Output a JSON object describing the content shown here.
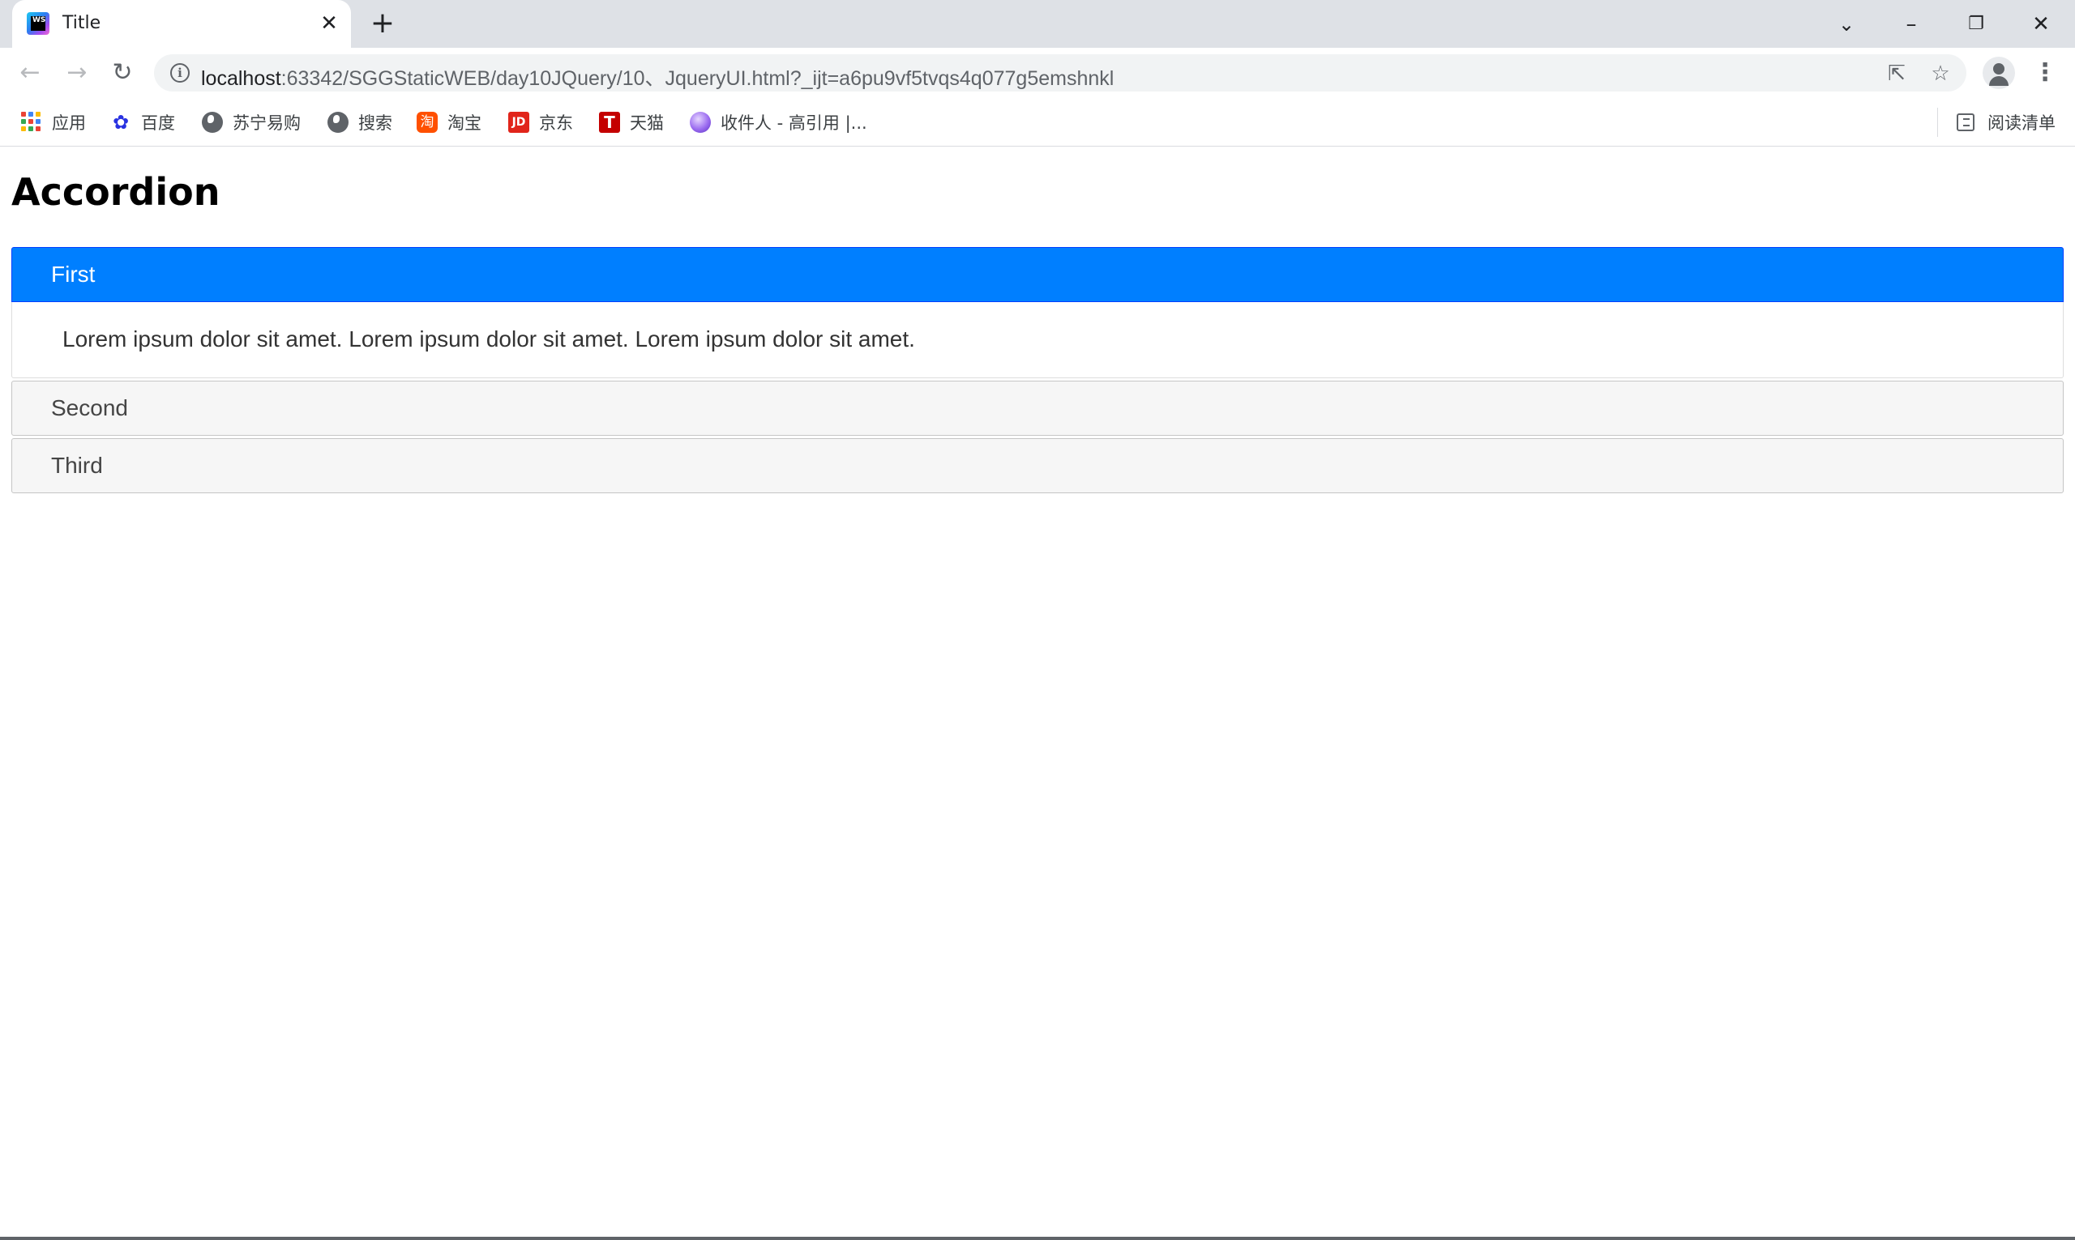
{
  "browser": {
    "tab_title": "Title",
    "tab_favicon_text": "WS",
    "url_host": "localhost",
    "url_rest": ":63342/SGGStaticWEB/day10JQuery/10、JqueryUI.html?_ijt=a6pu9vf5tvqs4q077g5emshnkl",
    "bookmarks": [
      {
        "label": "应用",
        "icon": "apps-icon"
      },
      {
        "label": "百度",
        "icon": "baidu-icon"
      },
      {
        "label": "苏宁易购",
        "icon": "globe-icon"
      },
      {
        "label": "搜索",
        "icon": "globe-icon"
      },
      {
        "label": "淘宝",
        "icon": "taobao-icon"
      },
      {
        "label": "京东",
        "icon": "jd-icon"
      },
      {
        "label": "天猫",
        "icon": "tmall-icon"
      },
      {
        "label": "收件人 - 高引用 |...",
        "icon": "orb-icon"
      }
    ],
    "reading_list": "阅读清单"
  },
  "page": {
    "title": "Accordion",
    "sections": [
      {
        "header": "First",
        "content": "Lorem ipsum dolor sit amet. Lorem ipsum dolor sit amet. Lorem ipsum dolor sit amet.",
        "expanded": true
      },
      {
        "header": "Second",
        "expanded": false
      },
      {
        "header": "Third",
        "expanded": false
      }
    ]
  },
  "colors": {
    "active_header": "#007fff",
    "inactive_header": "#f6f6f6",
    "tabstrip": "#dee1e6"
  }
}
